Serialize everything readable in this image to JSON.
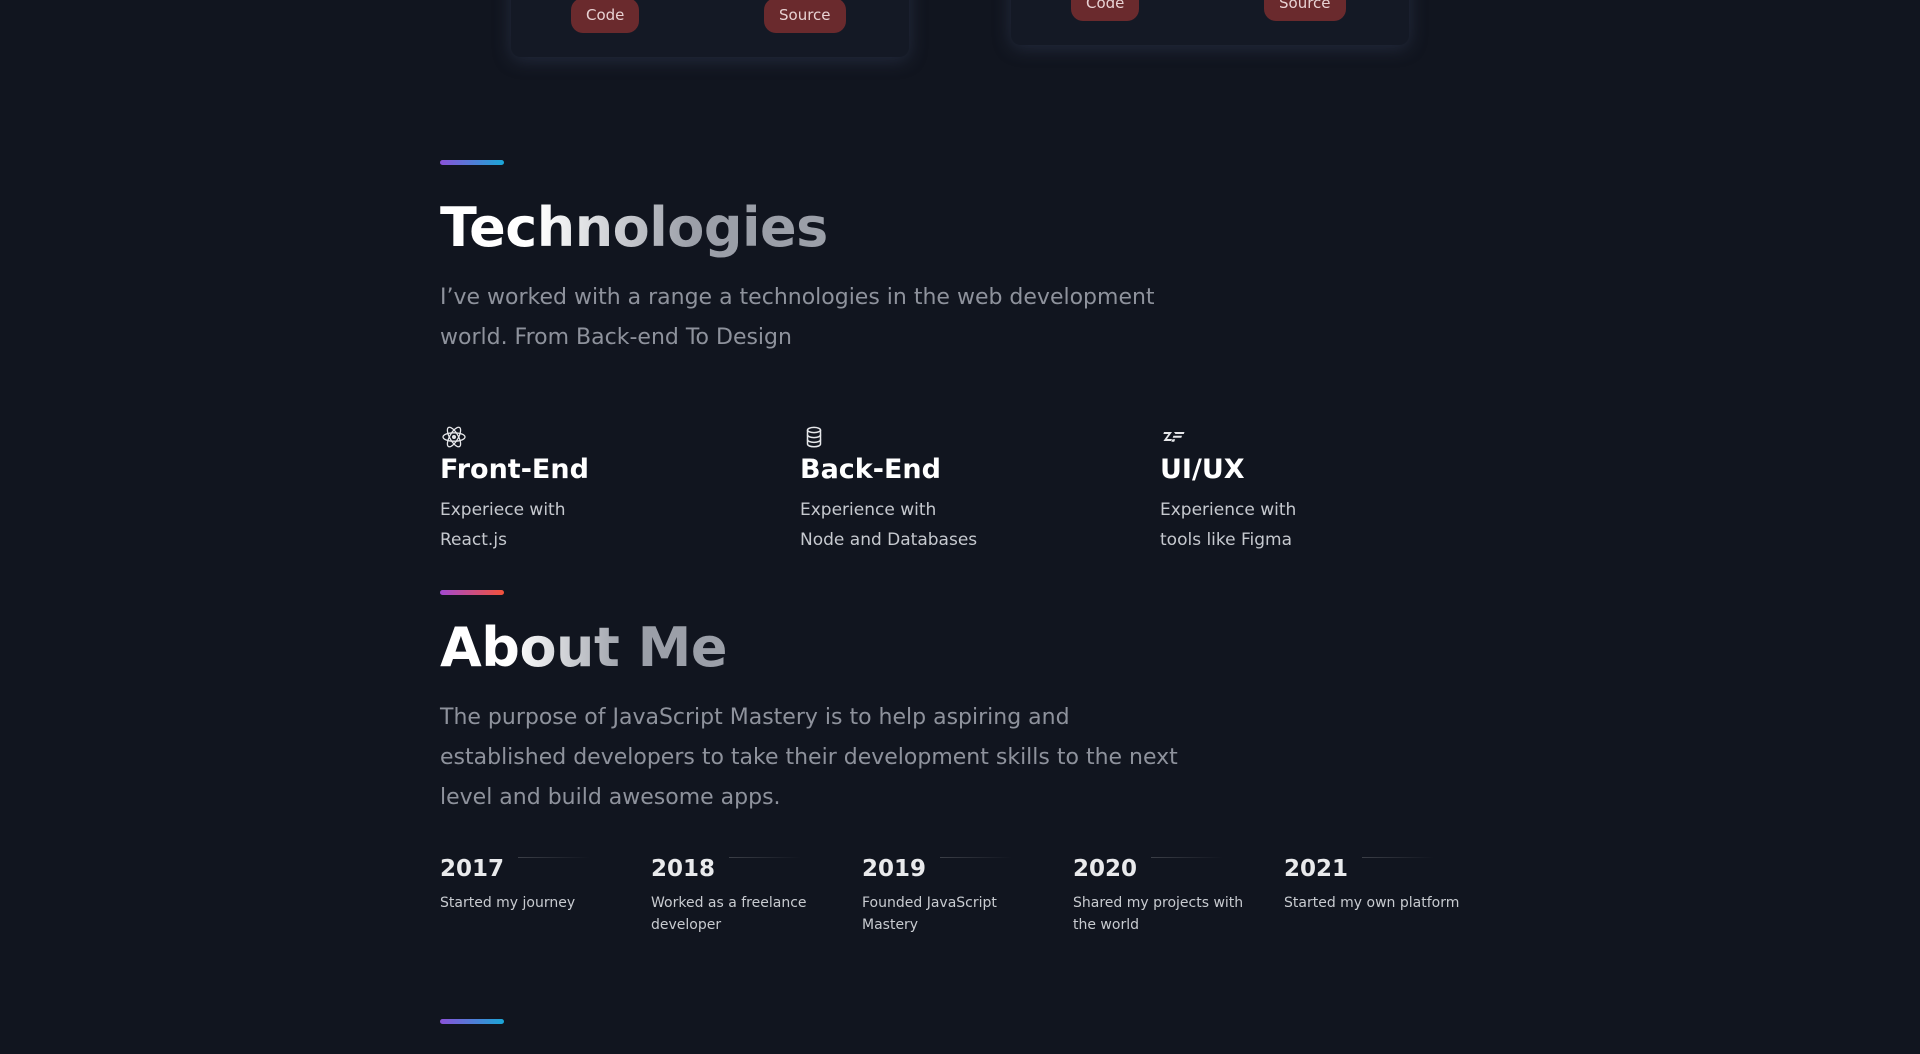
{
  "projects": [
    {
      "code_label": "Code",
      "source_label": "Source"
    },
    {
      "code_label": "Code",
      "source_label": "Source"
    }
  ],
  "technologies": {
    "title": "Technologies",
    "description_lines": [
      "I’ve worked with a range a technologies in the web development",
      "world. From Back-end To Design"
    ],
    "items": [
      {
        "icon": "react-icon",
        "title": "Front-End",
        "lines": [
          "Experiece with",
          "React.js"
        ]
      },
      {
        "icon": "database-icon",
        "title": "Back-End",
        "lines": [
          "Experience with",
          "Node and Databases"
        ]
      },
      {
        "icon": "zeplin-icon",
        "title": "UI/UX",
        "lines": [
          "Experience with",
          "tools like Figma"
        ]
      }
    ]
  },
  "about": {
    "title": "About Me",
    "description_lines": [
      "The purpose of JavaScript Mastery is to help aspiring and",
      "established developers to take their development skills to the next",
      "level and build awesome apps."
    ],
    "timeline": [
      {
        "year": "2017",
        "text": "Started my journey"
      },
      {
        "year": "2018",
        "text": "Worked as a freelance developer"
      },
      {
        "year": "2019",
        "text": "Founded JavaScript Mastery"
      },
      {
        "year": "2020",
        "text": "Shared my projects with the world"
      },
      {
        "year": "2021",
        "text": "Started my own platform"
      }
    ]
  },
  "colors": {
    "background": "#11151f",
    "button_bg": "#6a2a2d",
    "accent_blue_gradient": [
      "#8a52d8",
      "#1aa6d6"
    ],
    "accent_red_gradient": [
      "#a249d0",
      "#f3523a"
    ]
  }
}
